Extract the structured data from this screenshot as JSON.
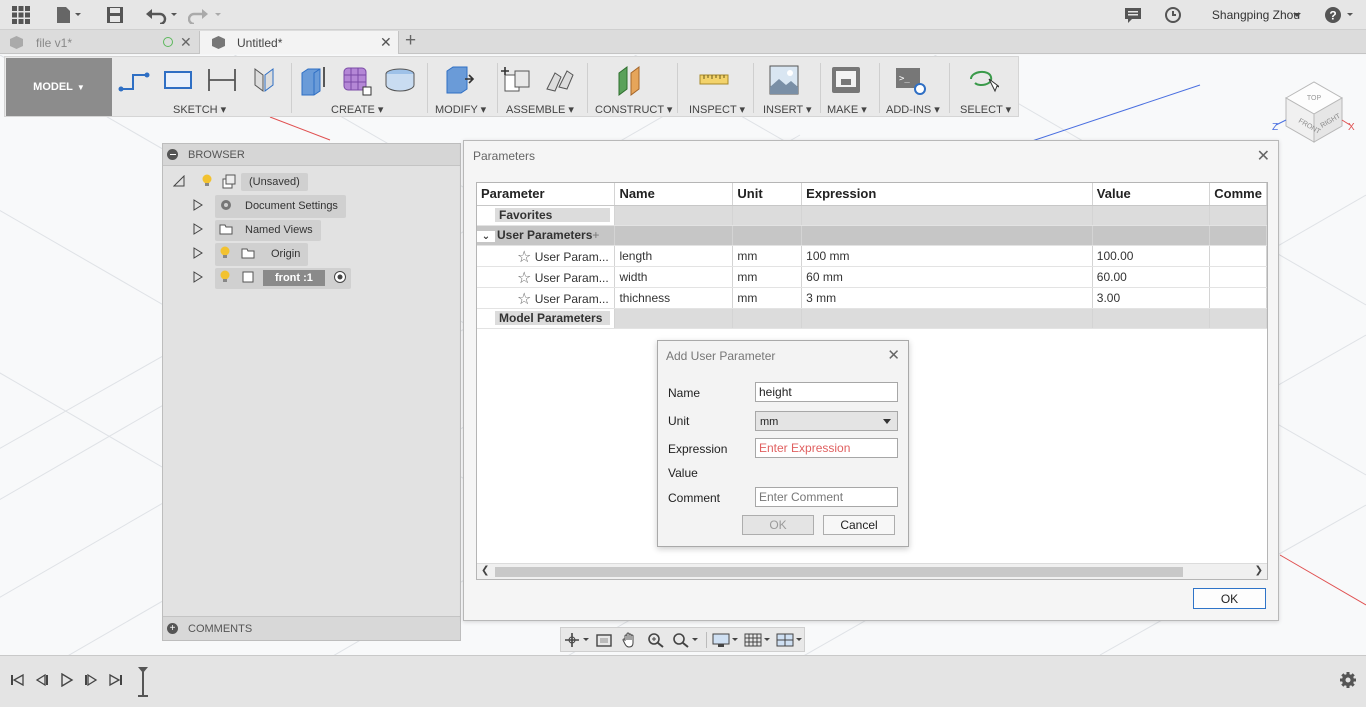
{
  "user": {
    "name": "Shangping Zhou"
  },
  "tabs": [
    {
      "label": "file v1*"
    },
    {
      "label": "Untitled*"
    }
  ],
  "toolbar": {
    "workspace": "MODEL",
    "groups": [
      {
        "label": "SKETCH"
      },
      {
        "label": "CREATE"
      },
      {
        "label": "MODIFY"
      },
      {
        "label": "ASSEMBLE"
      },
      {
        "label": "CONSTRUCT"
      },
      {
        "label": "INSPECT"
      },
      {
        "label": "INSERT"
      },
      {
        "label": "MAKE"
      },
      {
        "label": "ADD-INS"
      },
      {
        "label": "SELECT"
      }
    ]
  },
  "viewcube": {
    "top": "TOP",
    "front": "FRONT",
    "right": "RIGHT",
    "axis_z": "Z",
    "axis_x": "X"
  },
  "browser": {
    "title": "BROWSER",
    "root": "(Unsaved)",
    "items": [
      {
        "label": "Document Settings"
      },
      {
        "label": "Named Views"
      },
      {
        "label": "Origin"
      },
      {
        "label": "front :1"
      }
    ],
    "comments": "COMMENTS"
  },
  "parameters": {
    "title": "Parameters",
    "columns": [
      "Parameter",
      "Name",
      "Unit",
      "Expression",
      "Value",
      "Comme"
    ],
    "favorites_label": "Favorites",
    "user_params_label": "User Parameters",
    "model_params_label": "Model Parameters",
    "rows": [
      {
        "param": "User Param...",
        "name": "length",
        "unit": "mm",
        "expression": "100 mm",
        "value": "100.00"
      },
      {
        "param": "User Param...",
        "name": "width",
        "unit": "mm",
        "expression": "60 mm",
        "value": "60.00"
      },
      {
        "param": "User Param...",
        "name": "thichness",
        "unit": "mm",
        "expression": "3 mm",
        "value": "3.00"
      }
    ],
    "ok_label": "OK"
  },
  "add_param": {
    "title": "Add User Parameter",
    "name_label": "Name",
    "name_value": "height",
    "unit_label": "Unit",
    "unit_value": "mm",
    "expression_label": "Expression",
    "expression_placeholder": "Enter Expression",
    "value_label": "Value",
    "comment_label": "Comment",
    "comment_placeholder": "Enter Comment",
    "ok_label": "OK",
    "cancel_label": "Cancel"
  },
  "colors": {
    "accent": "#2f74c8",
    "bulb": "#f2c230",
    "axis_red": "#e05050",
    "axis_blue": "#4a6fe0"
  }
}
